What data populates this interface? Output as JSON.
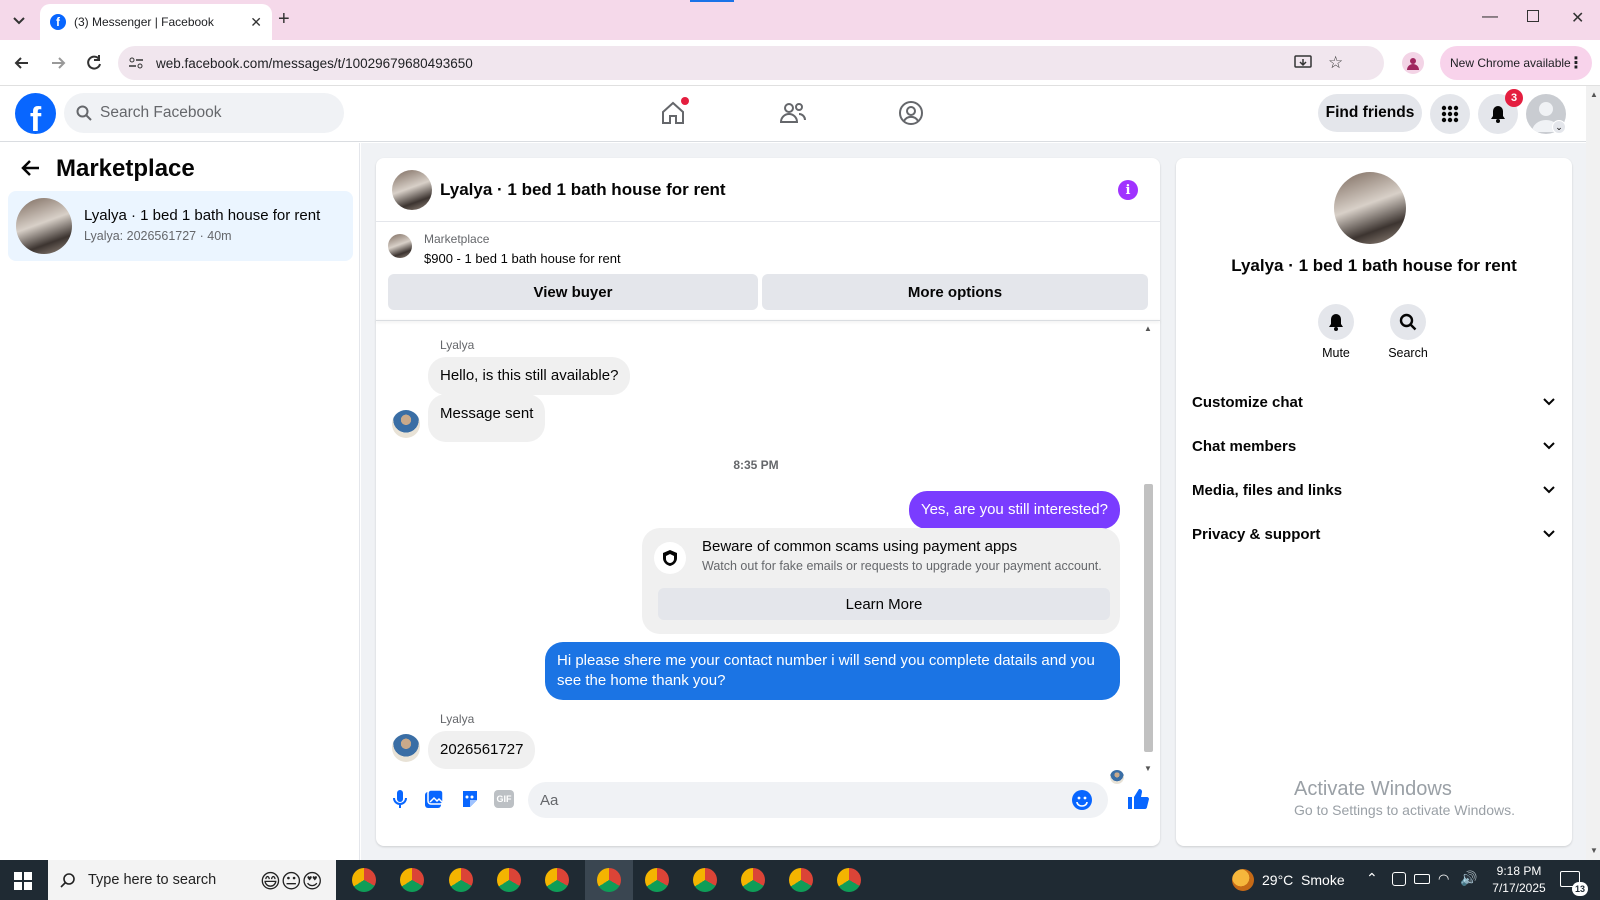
{
  "browser": {
    "tab_title": "(3) Messenger | Facebook",
    "url": "web.facebook.com/messages/t/10029679680493650",
    "update_label": "New Chrome available"
  },
  "fb_header": {
    "search_placeholder": "Search Facebook",
    "find_friends": "Find friends",
    "notification_count": "3"
  },
  "left_panel": {
    "title": "Marketplace",
    "conversations": [
      {
        "name": "Lyalya · 1 bed 1 bath house for rent",
        "preview": "Lyalya: 2026561727 · 40m"
      }
    ]
  },
  "chat": {
    "header_title": "Lyalya · 1 bed 1 bath house for rent",
    "listing": {
      "source": "Marketplace",
      "summary": "$900 - 1 bed 1 bath house for rent"
    },
    "view_buyer": "View buyer",
    "more_options": "More options",
    "messages": {
      "sender1": "Lyalya",
      "m1": "Hello, is this still available?",
      "m2": "Message sent",
      "timestamp": "8:35 PM",
      "m3": "Yes, are you still interested?",
      "scam_title": "Beware of common scams using payment apps",
      "scam_body": "Watch out for fake emails or requests to upgrade your payment account.",
      "learn_more": "Learn More",
      "m4": "Hi please shere me your contact number i will send you complete datails and you see the home thank you?",
      "sender2": "Lyalya",
      "m5": "2026561727"
    },
    "composer_placeholder": "Aa"
  },
  "info_panel": {
    "title": "Lyalya · 1 bed 1 bath house for rent",
    "mute": "Mute",
    "search": "Search",
    "sections": [
      "Customize chat",
      "Chat members",
      "Media, files and links",
      "Privacy & support"
    ],
    "watermark_title": "Activate Windows",
    "watermark_sub": "Go to Settings to activate Windows."
  },
  "taskbar": {
    "search_placeholder": "Type here to search",
    "weather": "29°C  Smoke",
    "time": "9:18 PM",
    "date": "7/17/2025",
    "notif_count": "13"
  },
  "colors": {
    "fb_blue": "#0866ff",
    "bubble_blue": "#1b74e4",
    "bubble_purple": "#7a3cff",
    "tab_bg": "#f5d9ea"
  }
}
